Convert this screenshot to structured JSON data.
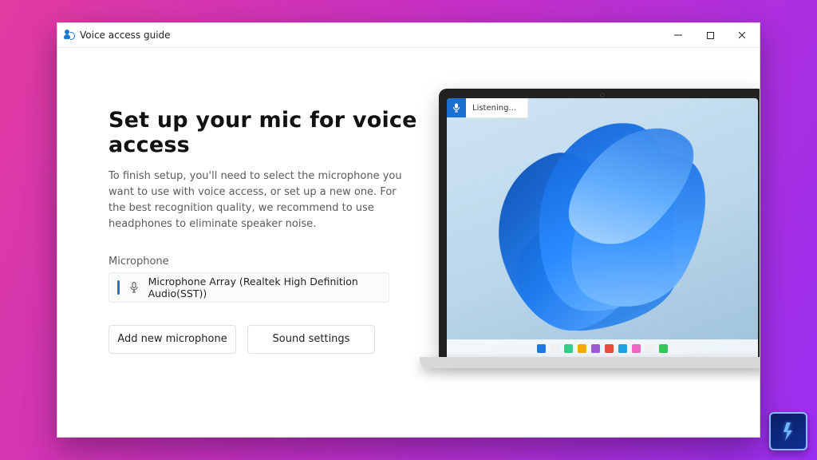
{
  "window": {
    "title": "Voice access guide"
  },
  "main": {
    "heading": "Set up your mic for voice access",
    "description": "To finish setup, you'll need to select the microphone you want to use with voice access, or set up a new one. For the best recognition quality, we recommend to use headphones to eliminate speaker noise.",
    "mic_label": "Microphone",
    "selected_mic": "Microphone Array (Realtek High Definition Audio(SST))",
    "add_button": "Add new microphone",
    "sound_button": "Sound settings"
  },
  "preview": {
    "status_label": "Listening...",
    "taskbar_icon_colors": [
      "#1f7ae0",
      "#f0f0f0",
      "#33cc88",
      "#f2a900",
      "#9b59d6",
      "#e74c3c",
      "#1fa2e0",
      "#f066c0",
      "#f0f0f0",
      "#34c759"
    ]
  },
  "colors": {
    "accent": "#1a78d6"
  }
}
